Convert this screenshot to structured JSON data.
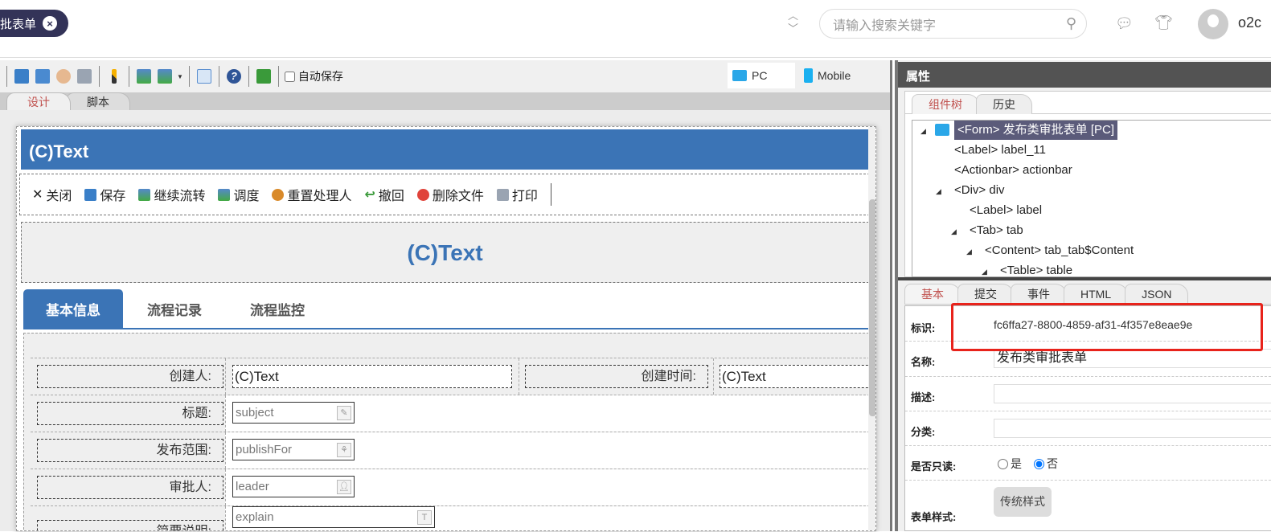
{
  "topbar": {
    "doc_tab": "批表单",
    "search_placeholder": "请输入搜索关键字",
    "username": "o2c",
    "icons": [
      "chevron-up-icon",
      "chevron-down-icon",
      "search-icon",
      "chat-icon",
      "skin-icon",
      "avatar"
    ]
  },
  "toolbar": {
    "autosave_label": "自动保存",
    "pc_label": "PC",
    "mobile_label": "Mobile"
  },
  "design_tabs": [
    "设计",
    "脚本"
  ],
  "form": {
    "header_text": "(C)Text",
    "actions": [
      "关闭",
      "保存",
      "继续流转",
      "调度",
      "重置处理人",
      "撤回",
      "删除文件",
      "打印"
    ],
    "title_text": "(C)Text",
    "tabs": [
      "基本信息",
      "流程记录",
      "流程监控"
    ],
    "rows": [
      {
        "label": "创建人:",
        "value": "(C)Text",
        "label2": "创建时间:",
        "value2": "(C)Text"
      },
      {
        "label": "标题:",
        "value": "subject"
      },
      {
        "label": "发布范围:",
        "value": "publishFor"
      },
      {
        "label": "审批人:",
        "value": "leader"
      },
      {
        "label": "简要说明:",
        "value": "explain"
      }
    ]
  },
  "props": {
    "title": "属性",
    "tree_tabs": [
      "组件树",
      "历史"
    ],
    "tree": [
      "<Form> 发布类审批表单 [PC]",
      "<Label> label_11",
      "<Actionbar> actionbar",
      "<Div> div",
      "<Label> label",
      "<Tab> tab",
      "<Content> tab_tab$Content",
      "<Table> table"
    ],
    "prop_tabs": [
      "基本",
      "提交",
      "事件",
      "HTML",
      "JSON"
    ],
    "fields": {
      "id_label": "标识:",
      "id_value": "fc6ffa27-8800-4859-af31-4f357e8eae9e",
      "name_label": "名称:",
      "name_value": "发布类审批表单",
      "desc_label": "描述:",
      "cat_label": "分类:",
      "readonly_label": "是否只读:",
      "yes": "是",
      "no": "否",
      "style_label": "表单样式:",
      "style_button": "传统样式"
    }
  },
  "colors": {
    "accent": "#3b74b6",
    "highlight": "#e8231b"
  }
}
